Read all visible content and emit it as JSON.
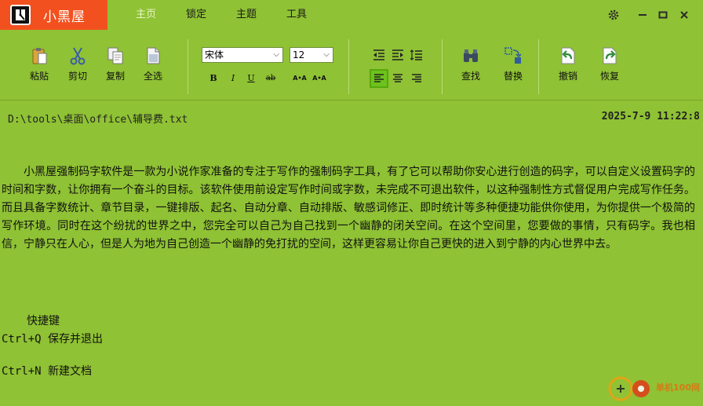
{
  "app": {
    "title": "小黑屋"
  },
  "menu": [
    {
      "label": "主页",
      "active": true
    },
    {
      "label": "锁定",
      "active": false
    },
    {
      "label": "主题",
      "active": false
    },
    {
      "label": "工具",
      "active": false
    }
  ],
  "toolbar": {
    "paste": "粘贴",
    "cut": "剪切",
    "copy": "复制",
    "select_all": "全选",
    "font_family": "宋体",
    "font_size": "12",
    "bold": "B",
    "italic": "I",
    "underline": "U",
    "strike": "ab",
    "grow": "A•A",
    "shrink": "A•A",
    "find": "查找",
    "replace": "替换",
    "undo": "撤销",
    "redo": "恢复"
  },
  "file": {
    "path": "D:\\tools\\桌面\\office\\辅导费.txt",
    "datetime": "2025-7-9 11:22:8"
  },
  "document": {
    "paragraph": "小黑屋强制码字软件是一款为小说作家准备的专注于写作的强制码字工具，有了它可以帮助你安心进行创造的码字，可以自定义设置码字的时间和字数，让你拥有一个奋斗的目标。该软件使用前设定写作时间或字数，未完成不可退出软件，以这种强制性方式督促用户完成写作任务。而且具备字数统计、章节目录，一键排版、起名、自动分章、自动排版、敏感词修正、即时统计等多种便捷功能供你使用，为你提供一个极简的写作环境。同时在这个纷扰的世界之中，您完全可以自己为自己找到一个幽静的闭关空间。在这个空间里，您要做的事情，只有码字。我也相信，宁静只在人心，但是人为地为自己创造一个幽静的免打扰的空间，这样更容易让你自己更快的进入到宁静的内心世界中去。",
    "shortcut_heading": "快捷键",
    "shortcuts": [
      "Ctrl+Q 保存并退出",
      "Ctrl+N 新建文档"
    ]
  },
  "watermark": "单机100网",
  "colors": {
    "background": "#8fc234",
    "brand": "#f2511f"
  }
}
